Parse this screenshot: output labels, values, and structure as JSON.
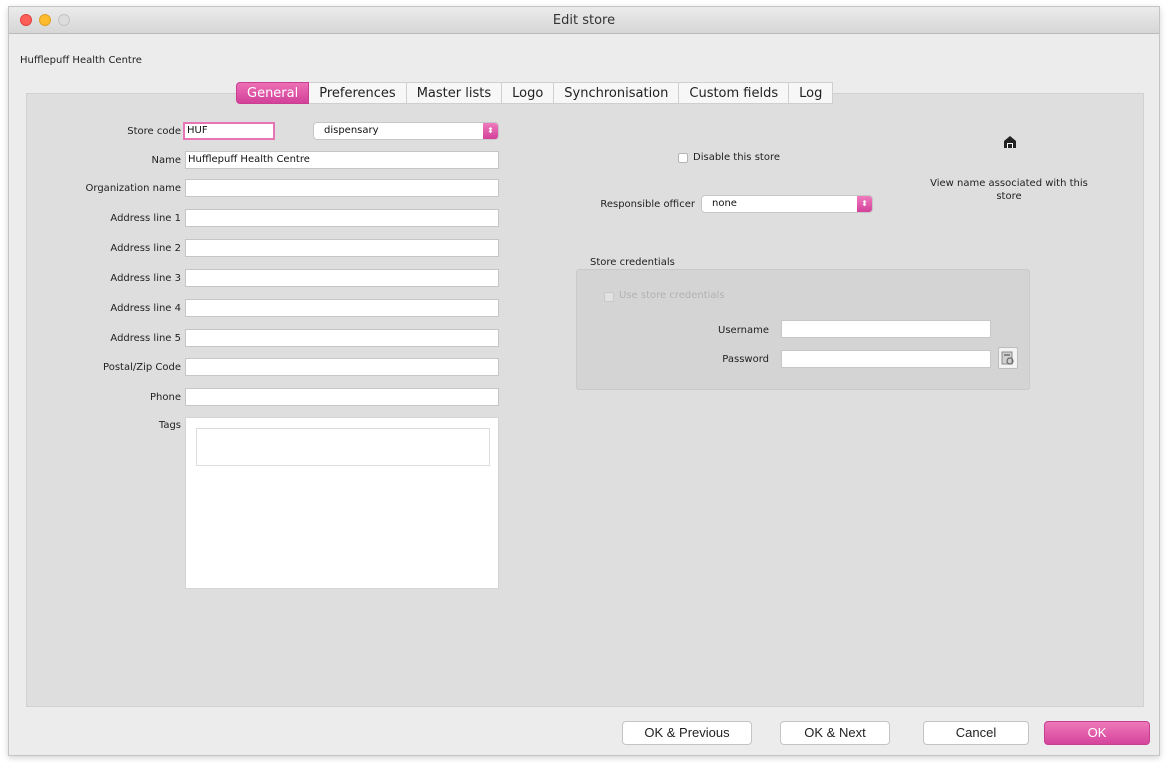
{
  "window": {
    "title": "Edit store"
  },
  "store_name": "Hufflepuff Health Centre",
  "tabs": [
    {
      "label": "General",
      "active": true
    },
    {
      "label": "Preferences"
    },
    {
      "label": "Master lists"
    },
    {
      "label": "Logo"
    },
    {
      "label": "Synchronisation"
    },
    {
      "label": "Custom fields"
    },
    {
      "label": "Log"
    }
  ],
  "form": {
    "store_code": {
      "label": "Store code",
      "value": "HUF"
    },
    "store_type": {
      "value": "dispensary"
    },
    "name": {
      "label": "Name",
      "value": "Hufflepuff Health Centre"
    },
    "organization_name": {
      "label": "Organization name",
      "value": ""
    },
    "address1": {
      "label": "Address line 1",
      "value": ""
    },
    "address2": {
      "label": "Address line 2",
      "value": ""
    },
    "address3": {
      "label": "Address line 3",
      "value": ""
    },
    "address4": {
      "label": "Address line 4",
      "value": ""
    },
    "address5": {
      "label": "Address line 5",
      "value": ""
    },
    "postal_code": {
      "label": "Postal/Zip Code",
      "value": ""
    },
    "phone": {
      "label": "Phone",
      "value": ""
    },
    "tags": {
      "label": "Tags"
    }
  },
  "right": {
    "disable_store": "Disable this store",
    "responsible_officer": {
      "label": "Responsible officer",
      "value": "none"
    },
    "view_name": "View name associated with this store",
    "credentials": {
      "title": "Store credentials",
      "use_label": "Use store credentials",
      "username_label": "Username",
      "username_value": "",
      "password_label": "Password",
      "password_value": ""
    }
  },
  "buttons": {
    "ok_previous": "OK & Previous",
    "ok_next": "OK & Next",
    "cancel": "Cancel",
    "ok": "OK"
  },
  "colors": {
    "accent": "#d3419a"
  },
  "icons": {
    "view_name": "building-icon",
    "password": "lookup-icon"
  }
}
